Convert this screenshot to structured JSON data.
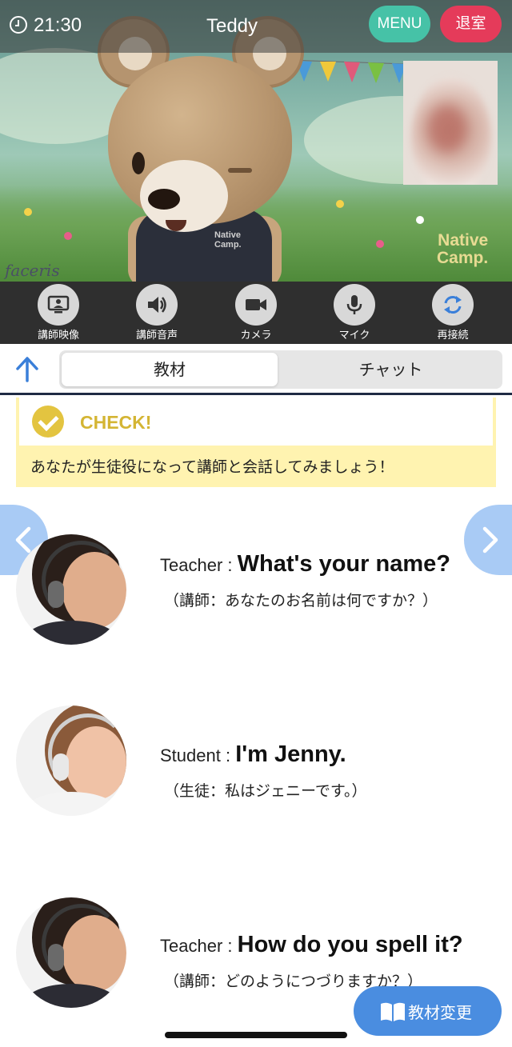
{
  "header": {
    "time": "21:30",
    "title": "Teddy",
    "menu_label": "MENU",
    "exit_label": "退室"
  },
  "video": {
    "watermark_left": "faceris",
    "watermark_right_1": "Native",
    "watermark_right_2": "Camp.",
    "bear_shirt_logo_1": "Native",
    "bear_shirt_logo_2": "Camp."
  },
  "controls": [
    {
      "label": "講師映像",
      "icon": "teacher-video-icon"
    },
    {
      "label": "講師音声",
      "icon": "speaker-icon"
    },
    {
      "label": "カメラ",
      "icon": "camera-icon"
    },
    {
      "label": "マイク",
      "icon": "microphone-icon"
    },
    {
      "label": "再接続",
      "icon": "reconnect-icon"
    }
  ],
  "tabs": {
    "material": "教材",
    "chat": "チャット",
    "active": "教材"
  },
  "check": {
    "title": "CHECK!",
    "instruction": "あなたが生徒役になって講師と会話してみましょう！"
  },
  "dialogue": [
    {
      "speaker": "Teacher",
      "separator": " : ",
      "sentence": "What's your name?",
      "translation": "（講師：あなたのお名前は何ですか？）"
    },
    {
      "speaker": "Student",
      "separator": " : ",
      "sentence": "I'm Jenny.",
      "translation": "（生徒：私はジェニーです。）"
    },
    {
      "speaker": "Teacher",
      "separator": " : ",
      "sentence": "How do you spell it?",
      "translation": "（講師：どのようにつづりますか？）"
    }
  ],
  "change_material_label": "教材変更",
  "colors": {
    "menu_button": "#46c2a7",
    "exit_button": "#e53b5a",
    "check_accent": "#d4b534",
    "check_background": "#fff3b0",
    "nav_arrow": "#a9cbf5",
    "primary_button": "#4a8de0",
    "up_arrow": "#3a7fd9"
  }
}
